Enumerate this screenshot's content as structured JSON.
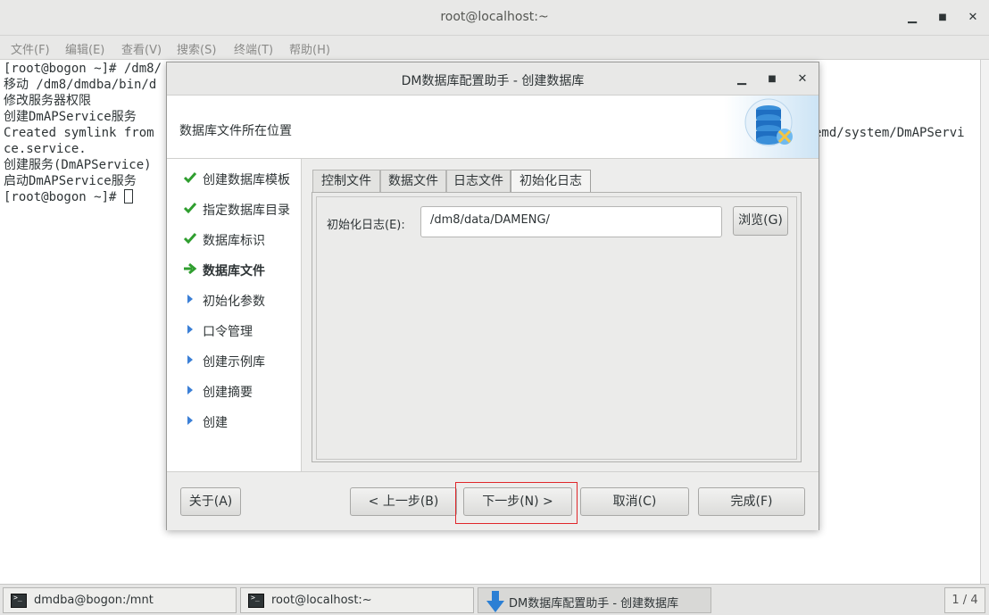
{
  "terminal": {
    "title": "root@localhost:~",
    "menu": [
      "文件(F)",
      "编辑(E)",
      "查看(V)",
      "搜索(S)",
      "终端(T)",
      "帮助(H)"
    ],
    "lines": [
      "[root@bogon ~]# /dm8/",
      "移动 /dm8/dmdba/bin/d",
      "修改服务器权限",
      "创建DmAPService服务",
      "Created symlink from",
      "ce.service.",
      "创建服务(DmAPService)",
      "启动DmAPService服务",
      "[root@bogon ~]# "
    ],
    "right_fragment": "emd/system/DmAPServi"
  },
  "dialog": {
    "title": "DM数据库配置助手 - 创建数据库",
    "header_text": "数据库文件所在位置",
    "steps": [
      {
        "label": "创建数据库模板",
        "state": "done"
      },
      {
        "label": "指定数据库目录",
        "state": "done"
      },
      {
        "label": "数据库标识",
        "state": "done"
      },
      {
        "label": "数据库文件",
        "state": "current"
      },
      {
        "label": "初始化参数",
        "state": "pending"
      },
      {
        "label": "口令管理",
        "state": "pending"
      },
      {
        "label": "创建示例库",
        "state": "pending"
      },
      {
        "label": "创建摘要",
        "state": "pending"
      },
      {
        "label": "创建",
        "state": "pending"
      }
    ],
    "tabs": [
      "控制文件",
      "数据文件",
      "日志文件",
      "初始化日志"
    ],
    "active_tab": "初始化日志",
    "field_label": "初始化日志(E):",
    "field_value": "/dm8/data/DAMENG/",
    "browse_label": "浏览(G)",
    "buttons": {
      "about": "关于(A)",
      "prev": "< 上一步(B)",
      "next": "下一步(N) >",
      "cancel": "取消(C)",
      "finish": "完成(F)"
    }
  },
  "taskbar": {
    "items": [
      "dmdba@bogon:/mnt",
      "root@localhost:~",
      "DM数据库配置助手 - 创建数据库"
    ],
    "pager": "1 / 4"
  },
  "colors": {
    "done_check": "#2f9e2f",
    "current_arrow": "#2f9e2f",
    "pending_arrow": "#3b7fd6",
    "highlight": "#e0262a"
  }
}
